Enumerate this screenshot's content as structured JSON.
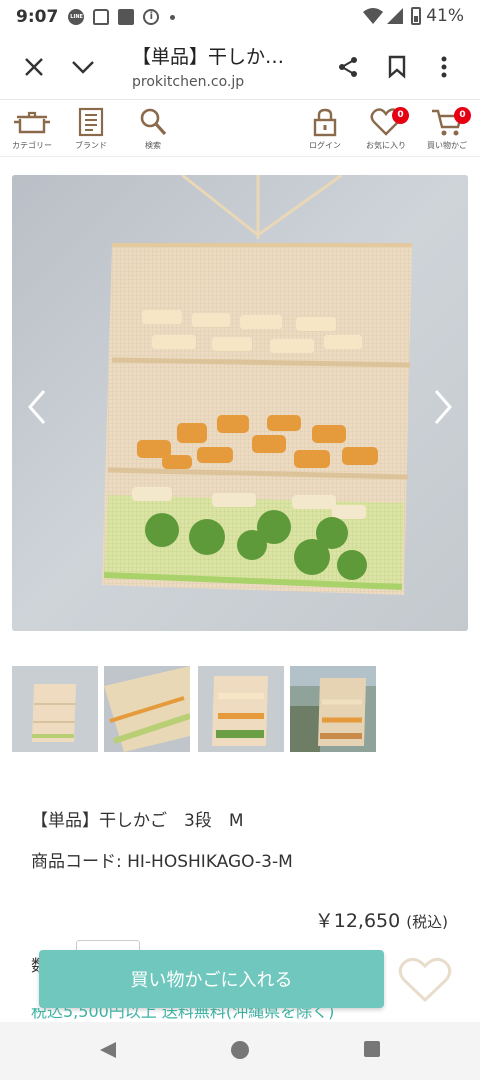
{
  "status_bar": {
    "time": "9:07",
    "battery": "41%",
    "icons": [
      "line-icon",
      "bag-icon",
      "square-icon",
      "info-icon",
      "dot-icon",
      "wifi-icon",
      "signal-icon",
      "battery-icon"
    ]
  },
  "browser": {
    "title": "【単品】干しか…",
    "url": "prokitchen.co.jp",
    "icons": [
      "close-icon",
      "chevron-down-icon",
      "share-icon",
      "bookmark-icon",
      "more-vert-icon"
    ]
  },
  "site_header": {
    "left_items": [
      {
        "label": "カテゴリー",
        "icon": "pot-icon"
      },
      {
        "label": "ブランド",
        "icon": "document-icon"
      },
      {
        "label": "検索",
        "icon": "search-icon"
      }
    ],
    "right_items": [
      {
        "label": "ログイン",
        "icon": "lock-icon"
      },
      {
        "label": "お気に入り",
        "icon": "heart-icon",
        "badge": "0"
      },
      {
        "label": "買い物かご",
        "icon": "cart-icon",
        "badge": "0"
      }
    ],
    "accent_color": "#e60012",
    "icon_color": "#8a6a4a"
  },
  "product": {
    "name": "【単品】干しかご　3段　M",
    "code": "商品コード: HI-HOSHIKAGO-3-M",
    "price": "￥12,650",
    "tax_label": "(税込)",
    "qty_label": "数",
    "add_to_cart_label": "買い物かごに入れる",
    "shipping_note": "税込5,500円以上 送料無料(沖縄県を除く)",
    "thumbnail_count": 4,
    "active_thumbnail": 3
  },
  "colors": {
    "button_teal": "#6fc7bd",
    "link_teal": "#3cb2a3"
  },
  "nav_bar": {
    "icons": [
      "back-icon",
      "home-icon",
      "recents-icon"
    ]
  }
}
